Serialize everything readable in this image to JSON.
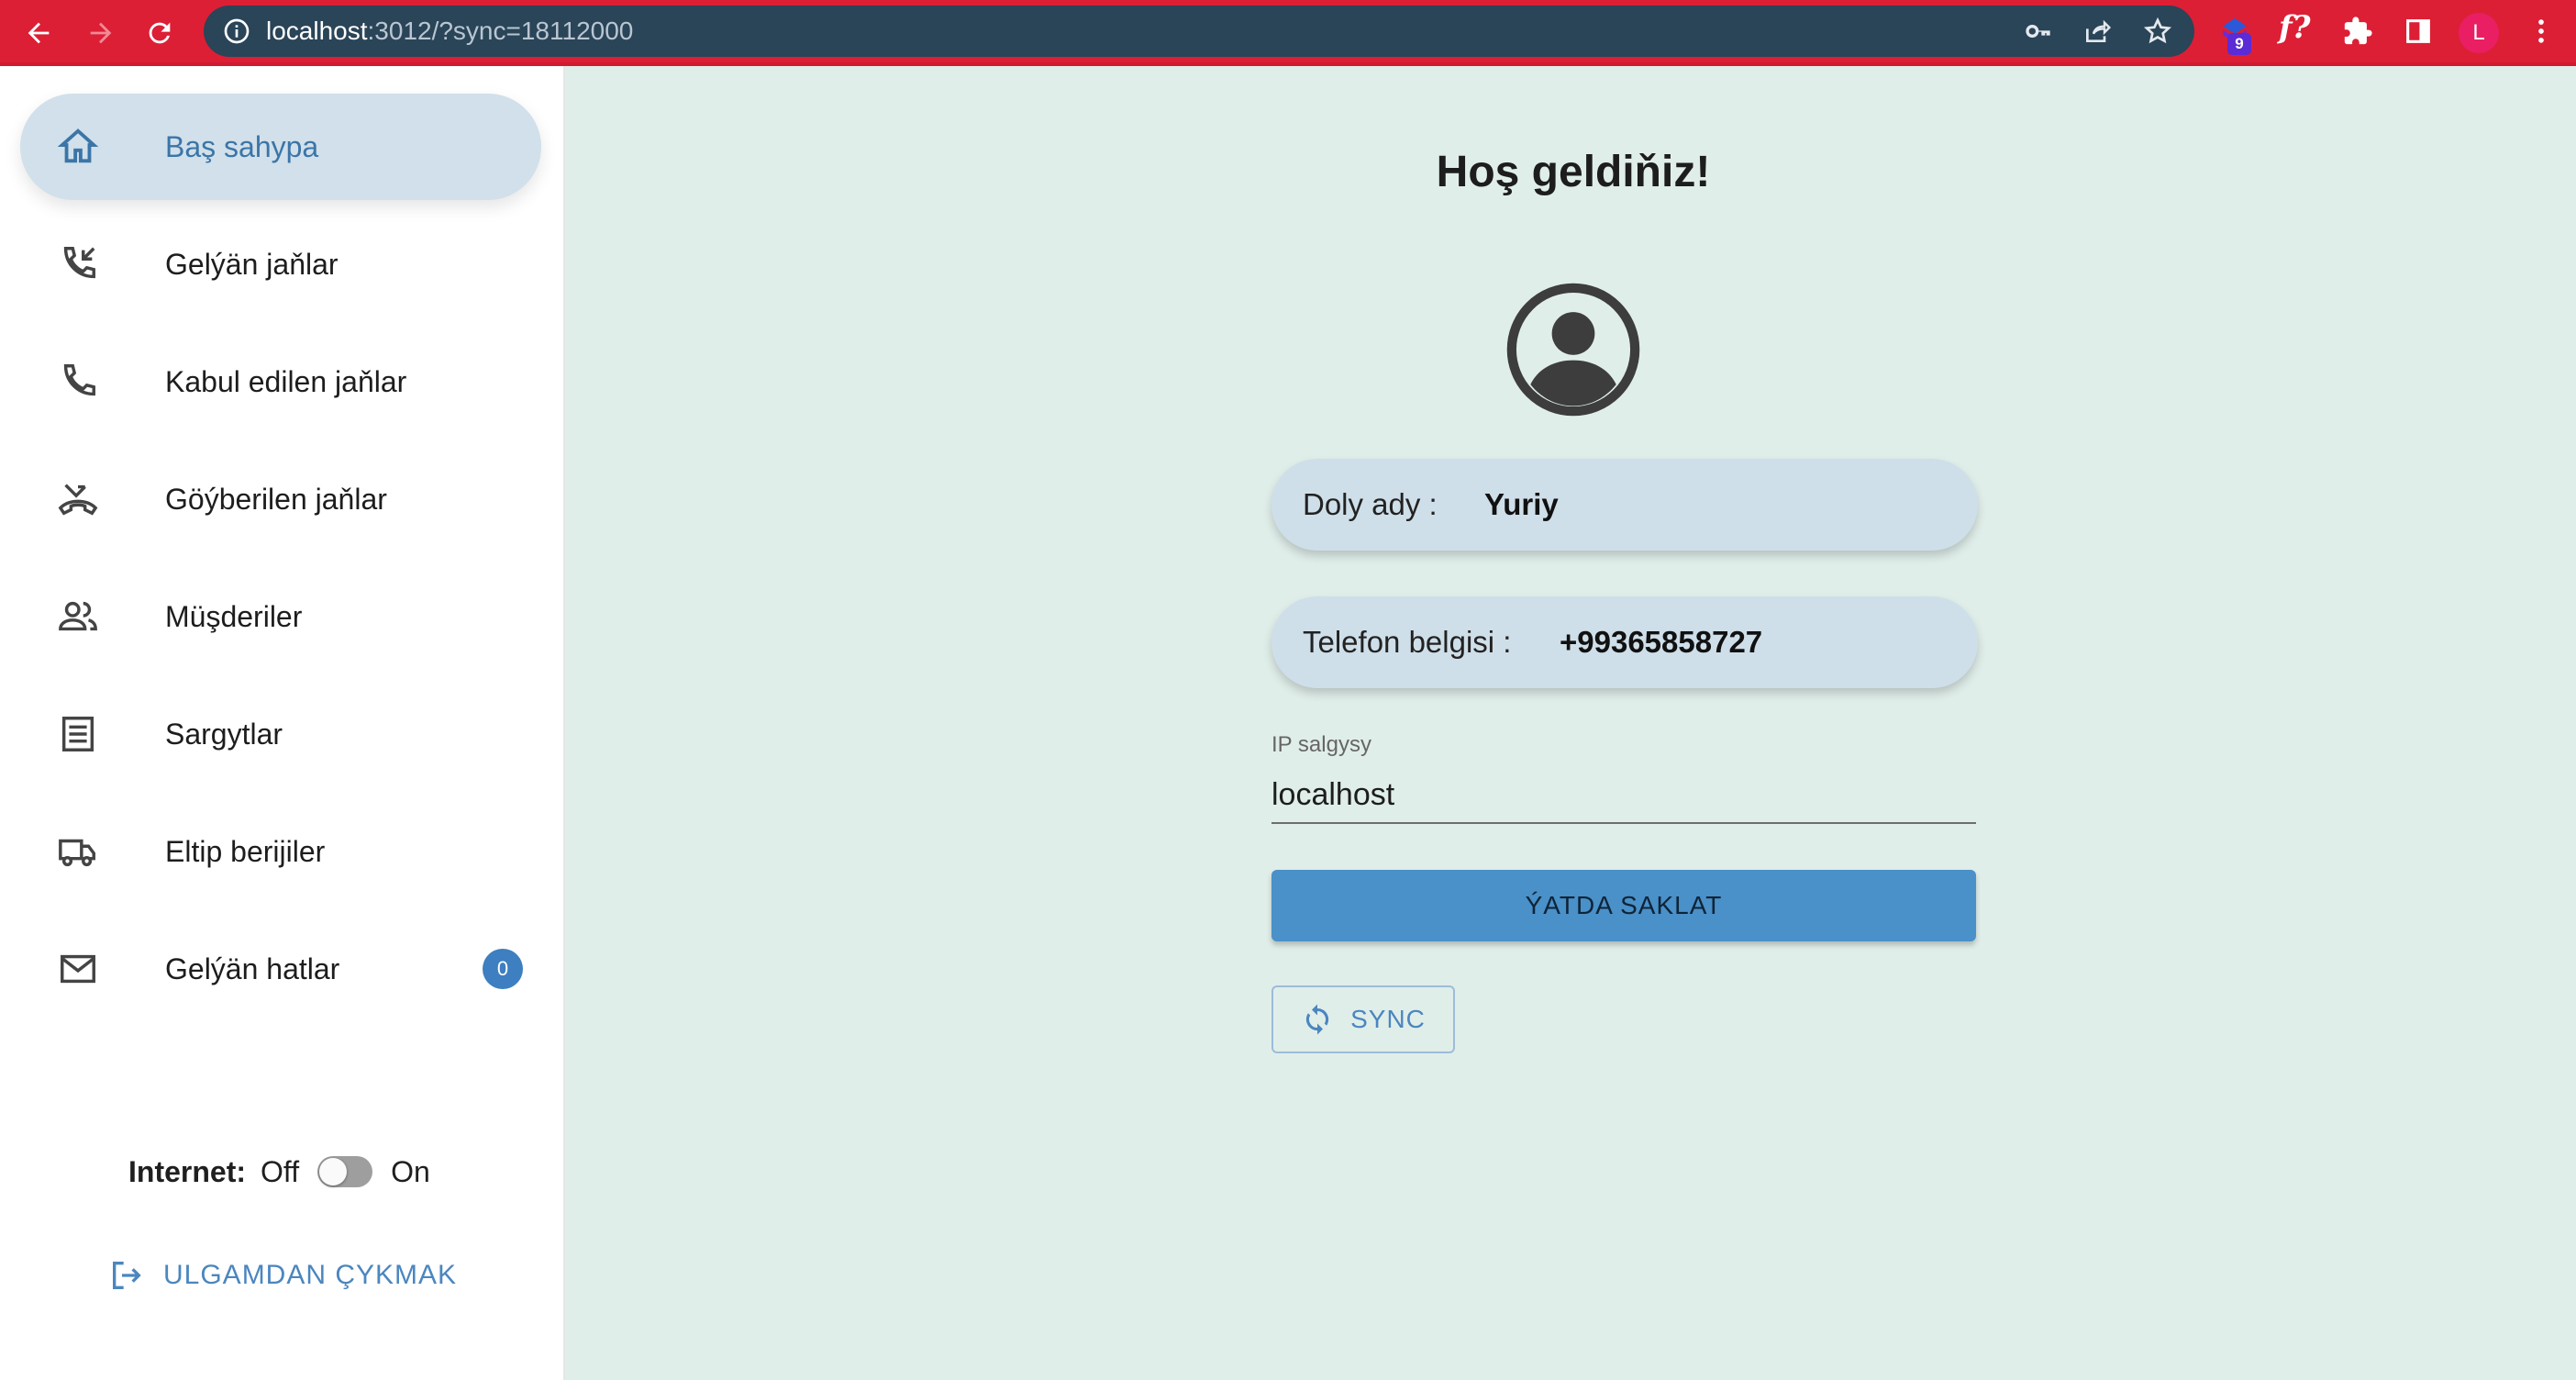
{
  "browser": {
    "url_host": "localhost",
    "url_path": ":3012/?sync=18112000",
    "extension_badge": "9",
    "fq_label": "f?",
    "profile_initial": "L",
    "icons": [
      "back-icon",
      "forward-icon",
      "reload-icon",
      "info-icon",
      "key-icon",
      "share-icon",
      "star-icon",
      "extension-icon",
      "puzzle-icon",
      "sidepanel-icon",
      "menu-icon"
    ]
  },
  "sidebar": {
    "items": [
      {
        "label": "Baş sahypa",
        "icon": "home-icon",
        "active": true
      },
      {
        "label": "Gelýän jaňlar",
        "icon": "incoming-call-icon"
      },
      {
        "label": "Kabul edilen jaňlar",
        "icon": "phone-icon"
      },
      {
        "label": "Göýberilen jaňlar",
        "icon": "missed-call-icon"
      },
      {
        "label": "Müşderiler",
        "icon": "people-icon"
      },
      {
        "label": "Sargytlar",
        "icon": "list-icon"
      },
      {
        "label": "Eltip berijiler",
        "icon": "truck-icon"
      },
      {
        "label": "Gelýän hatlar",
        "icon": "mail-icon",
        "badge": "0"
      }
    ],
    "internet": {
      "label": "Internet:",
      "off": "Off",
      "on": "On",
      "state": "off"
    },
    "logout_label": "ULGAMDAN ÇYKMAK"
  },
  "main": {
    "title": "Hoş geldiňiz!",
    "full_name": {
      "label": "Doly ady :",
      "value": "Yuriy"
    },
    "phone": {
      "label": "Telefon belgisi :",
      "value": "+99365858727"
    },
    "ip": {
      "label": "IP salgysy",
      "value": "localhost"
    },
    "save_label": "ÝATDA SAKLAT",
    "sync_label": "SYNC"
  },
  "colors": {
    "chrome": "#dc1f35",
    "omnibox": "#2a4458",
    "page_bg": "#e0eeea",
    "accent": "#4a90c9",
    "active_nav": "#d1e0ea"
  }
}
